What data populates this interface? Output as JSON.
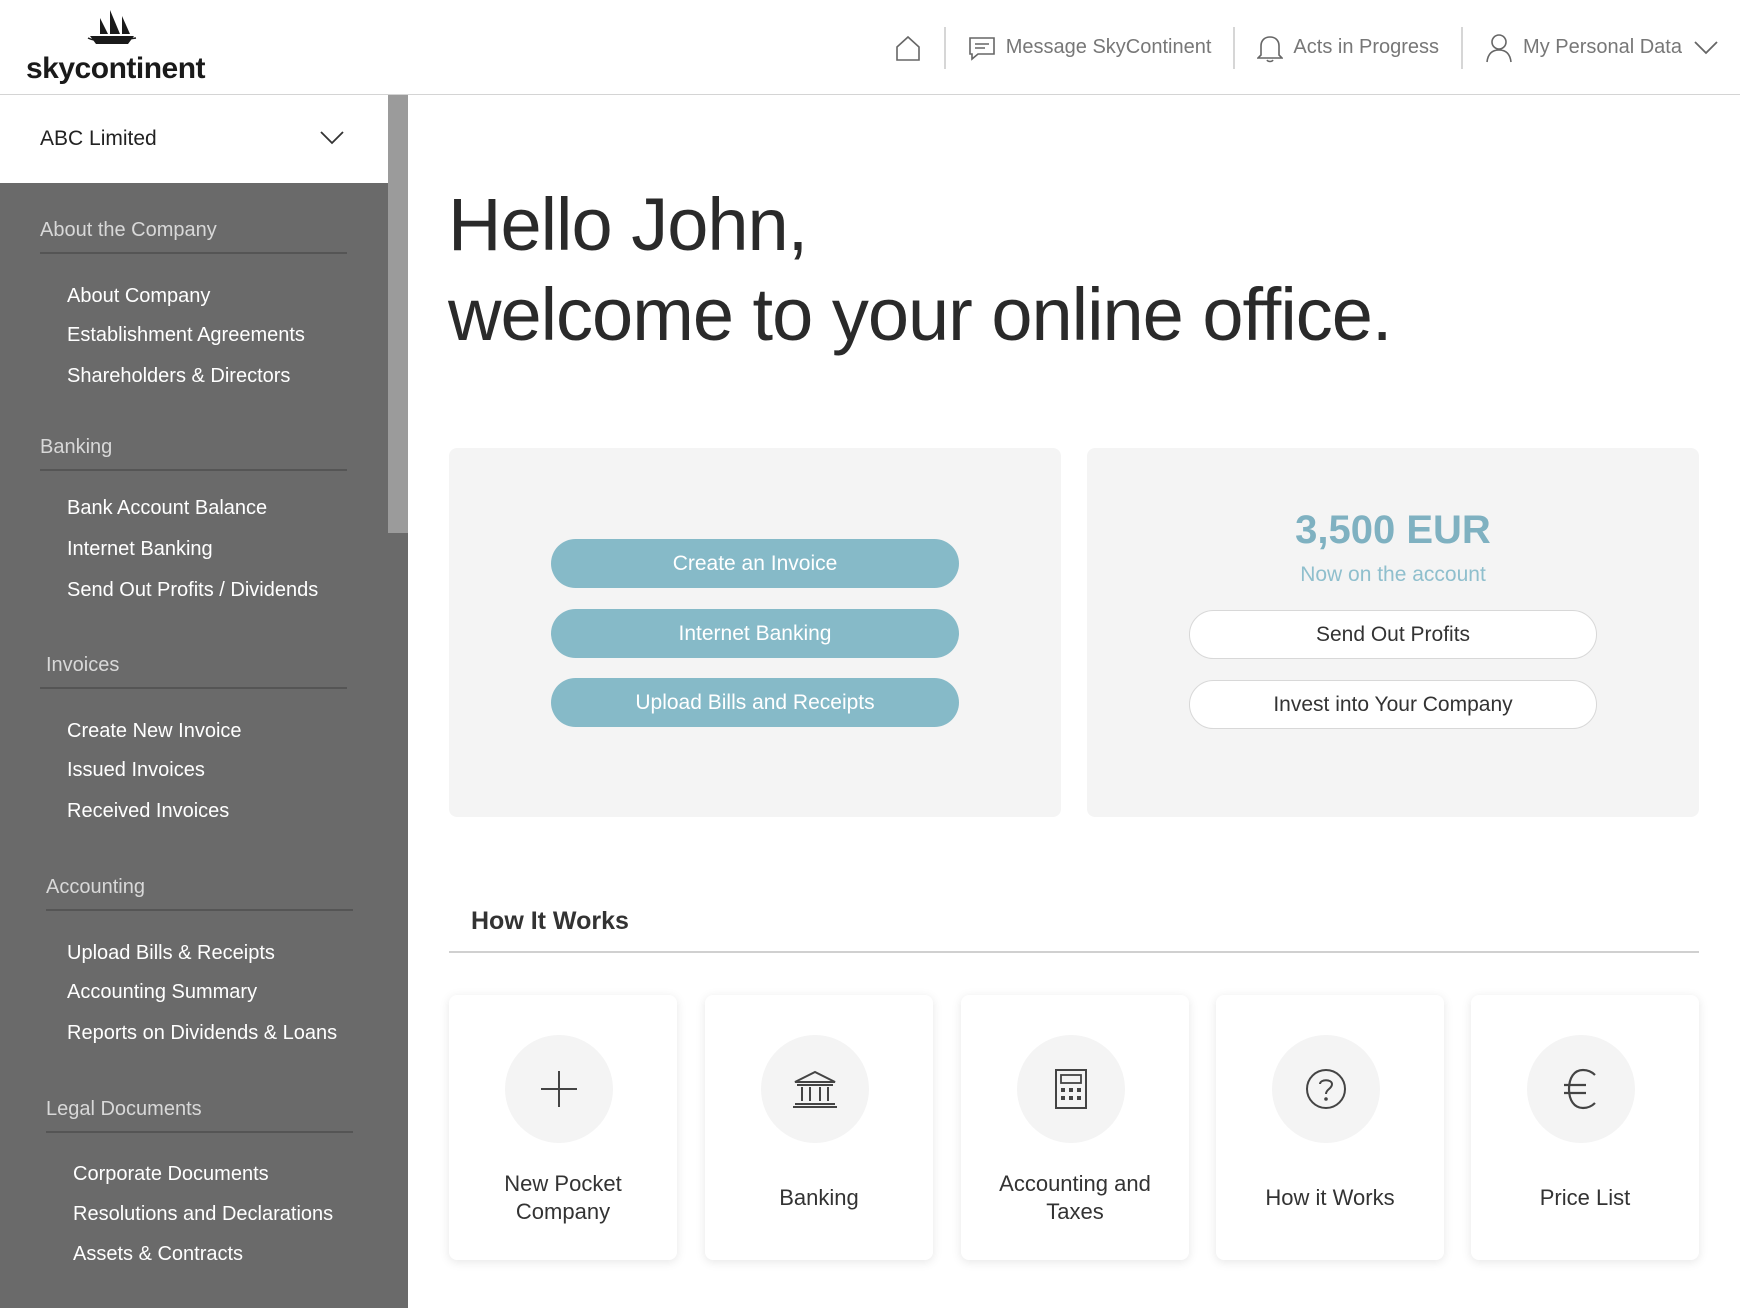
{
  "brand": {
    "name": "skycontinent"
  },
  "nav": {
    "home_icon": "home-icon",
    "message": "Message SkyContinent",
    "acts": "Acts in Progress",
    "personal": "My Personal Data"
  },
  "sidebar": {
    "company": "ABC Limited",
    "groups": [
      {
        "heading": "About the Company",
        "items": [
          "About Company",
          "Establishment Agreements",
          "Shareholders & Directors"
        ]
      },
      {
        "heading": "Banking",
        "items": [
          "Bank Account Balance",
          "Internet Banking",
          "Send Out Profits / Dividends"
        ]
      },
      {
        "heading": "Invoices",
        "items": [
          "Create New Invoice",
          "Issued Invoices",
          "Received Invoices"
        ]
      },
      {
        "heading": "Accounting",
        "items": [
          "Upload Bills & Receipts",
          "Accounting Summary",
          "Reports on Dividends & Loans"
        ]
      },
      {
        "heading": "Legal Documents",
        "items": [
          "Corporate Documents",
          "Resolutions and Declarations",
          "Assets & Contracts"
        ]
      }
    ]
  },
  "greeting": {
    "line1": "Hello John,",
    "line2": "welcome to your online office."
  },
  "actions": {
    "create_invoice": "Create an Invoice",
    "internet_banking": "Internet Banking",
    "upload_bills": "Upload Bills and Receipts"
  },
  "account": {
    "balance": "3,500 EUR",
    "caption": "Now on the account",
    "send_profits": "Send Out Profits",
    "invest": "Invest into Your Company"
  },
  "how_it_works": {
    "title": "How It Works",
    "cards": [
      {
        "label": "New Pocket Company",
        "icon": "plus-icon"
      },
      {
        "label": "Banking",
        "icon": "bank-icon"
      },
      {
        "label": "Accounting and Taxes",
        "icon": "calculator-icon"
      },
      {
        "label": "How it Works",
        "icon": "question-icon"
      },
      {
        "label": "Price List",
        "icon": "euro-icon"
      }
    ]
  },
  "colors": {
    "accent": "#86bac8",
    "sidebar": "#6a6a6a",
    "panel": "#f4f4f4"
  }
}
